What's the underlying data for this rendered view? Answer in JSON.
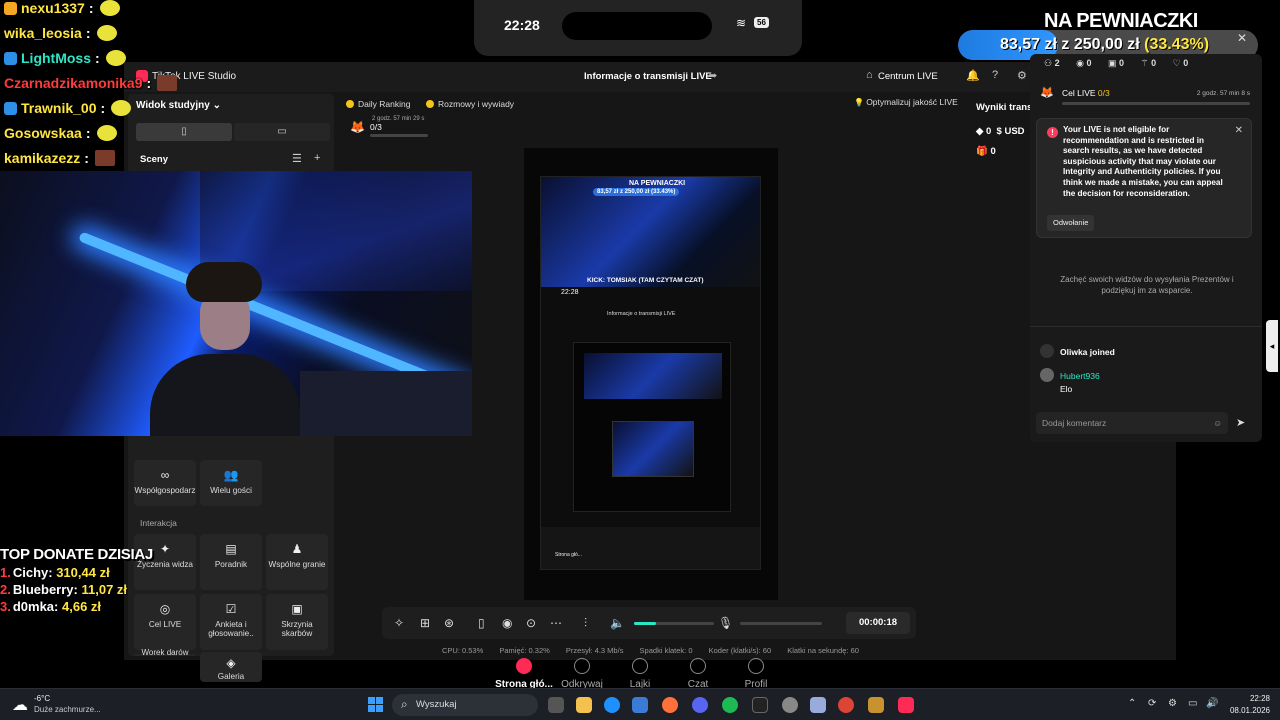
{
  "chat": [
    {
      "user": "nexu1337",
      "color": "#ffe641",
      "badge": "#f5a623"
    },
    {
      "user": "wika_leosia",
      "color": "#ffe641",
      "badge": null
    },
    {
      "user": "LightMoss",
      "color": "#2ee6c6",
      "badge": "#2e8fe6"
    },
    {
      "user": "Czarnadzikamonika9",
      "color": "#ff3b3b",
      "badge": null
    },
    {
      "user": "Trawnik_00",
      "color": "#ffe641",
      "badge": "#2e8fe6"
    },
    {
      "user": "Gosowskaa",
      "color": "#ffe641",
      "badge": null
    },
    {
      "user": "kamikazezz",
      "color": "#ffe641",
      "badge": null
    }
  ],
  "chat_sep": ":",
  "phone": {
    "time": "22:28",
    "battery": "56"
  },
  "goal": {
    "title": "NA PEWNIACZKI",
    "current": "83,57 zł",
    "of": "z",
    "target": "250,00 zł",
    "pct_label": "(33.43%)",
    "progress": 0.3343,
    "timer": "00:00:18"
  },
  "studio": {
    "app_name": "TikTok LIVE Studio",
    "center_title": "Informacje o transmisji LIVE",
    "centrum": "Centrum LIVE",
    "notif_count": "2",
    "studio_select": "Widok studyjny",
    "sceny": "Sceny",
    "daily_ranking": "Daily Ranking",
    "rozmowy": "Rozmowy i wywiady",
    "rank_val": "0/3",
    "rank_time": "2 godz. 57 min 29 s",
    "optymalizuj": "Optymalizuj jakość LIVE",
    "tiles_top": [
      "Współgospodarz",
      "Wielu gości"
    ],
    "interakcja": "Interakcja",
    "tiles": [
      "Życzenia widza",
      "Poradnik",
      "Wspólne granie",
      "Cel LIVE",
      "Ankieta i głosowanie..",
      "Skrzynia skarbów",
      "Worek darów",
      "Galeria"
    ],
    "timer": "00:00:18",
    "stats": [
      "CPU: 0.53%",
      "Pamięć: 0.32%",
      "Przesył: 4.3 Mb/s",
      "Spadki klatek: 0",
      "Koder (klatki/s): 60",
      "Klatki na sekundę: 60"
    ],
    "wyniki": "Wyniki transmisji LIVE",
    "rs_coins": "0",
    "rs_usd": "USD",
    "rs_gift": "0"
  },
  "preview": {
    "title": "NA PEWNIACZKI",
    "amount": "83,57 zł z 250,00 zł (33.43%)",
    "kick": "KICK: TOMSIAK (TAM CZYTAM CZAT)",
    "time": "22:28",
    "info": "Informacje o transmisji LIVE",
    "strona": "Strona głó..."
  },
  "panel": {
    "icons": [
      "2",
      "0",
      "0",
      "0",
      "0"
    ],
    "cel_label": "Cel LIVE",
    "cel_val": "0/3",
    "cel_time": "2 godz. 57 min 8 s",
    "alert": "Your LIVE is not eligible for recommendation and is restricted in search results, as we have detected suspicious activity that may violate our Integrity and Authenticity policies. If you think we made a mistake, you can appeal the decision for reconsideration.",
    "alert_btn": "Odwołanie",
    "gift_hint": "Zachęć swoich widzów do wysyłania Prezentów i podziękuj im za wsparcie.",
    "joined_user": "Oliwka",
    "joined_text": "joined",
    "comment_user": "Hubert936",
    "comment_text": "Elo",
    "input_placeholder": "Dodaj komentarz"
  },
  "donate": {
    "title": "TOP DONATE DZISIAJ",
    "rows": [
      {
        "n": "1.",
        "name": "Cichy:",
        "amt": "310,44 zł"
      },
      {
        "n": "2.",
        "name": "Blueberry:",
        "amt": "11,07 zł"
      },
      {
        "n": "3.",
        "name": "d0mka:",
        "amt": "4,66 zł"
      }
    ]
  },
  "phone_tabs": [
    "Strona głó...",
    "Odkrywaj",
    "Lajki",
    "Czat",
    "Profil"
  ],
  "taskbar": {
    "temp": "-6°C",
    "cond": "Duże zachmurze...",
    "search": "Wyszukaj",
    "time": "22:28",
    "date": "08.01.2026"
  },
  "colors": {
    "accent": "#ff2a55",
    "teal": "#2ee6c6",
    "gold": "#ffe641",
    "blue": "#2f96ff"
  }
}
